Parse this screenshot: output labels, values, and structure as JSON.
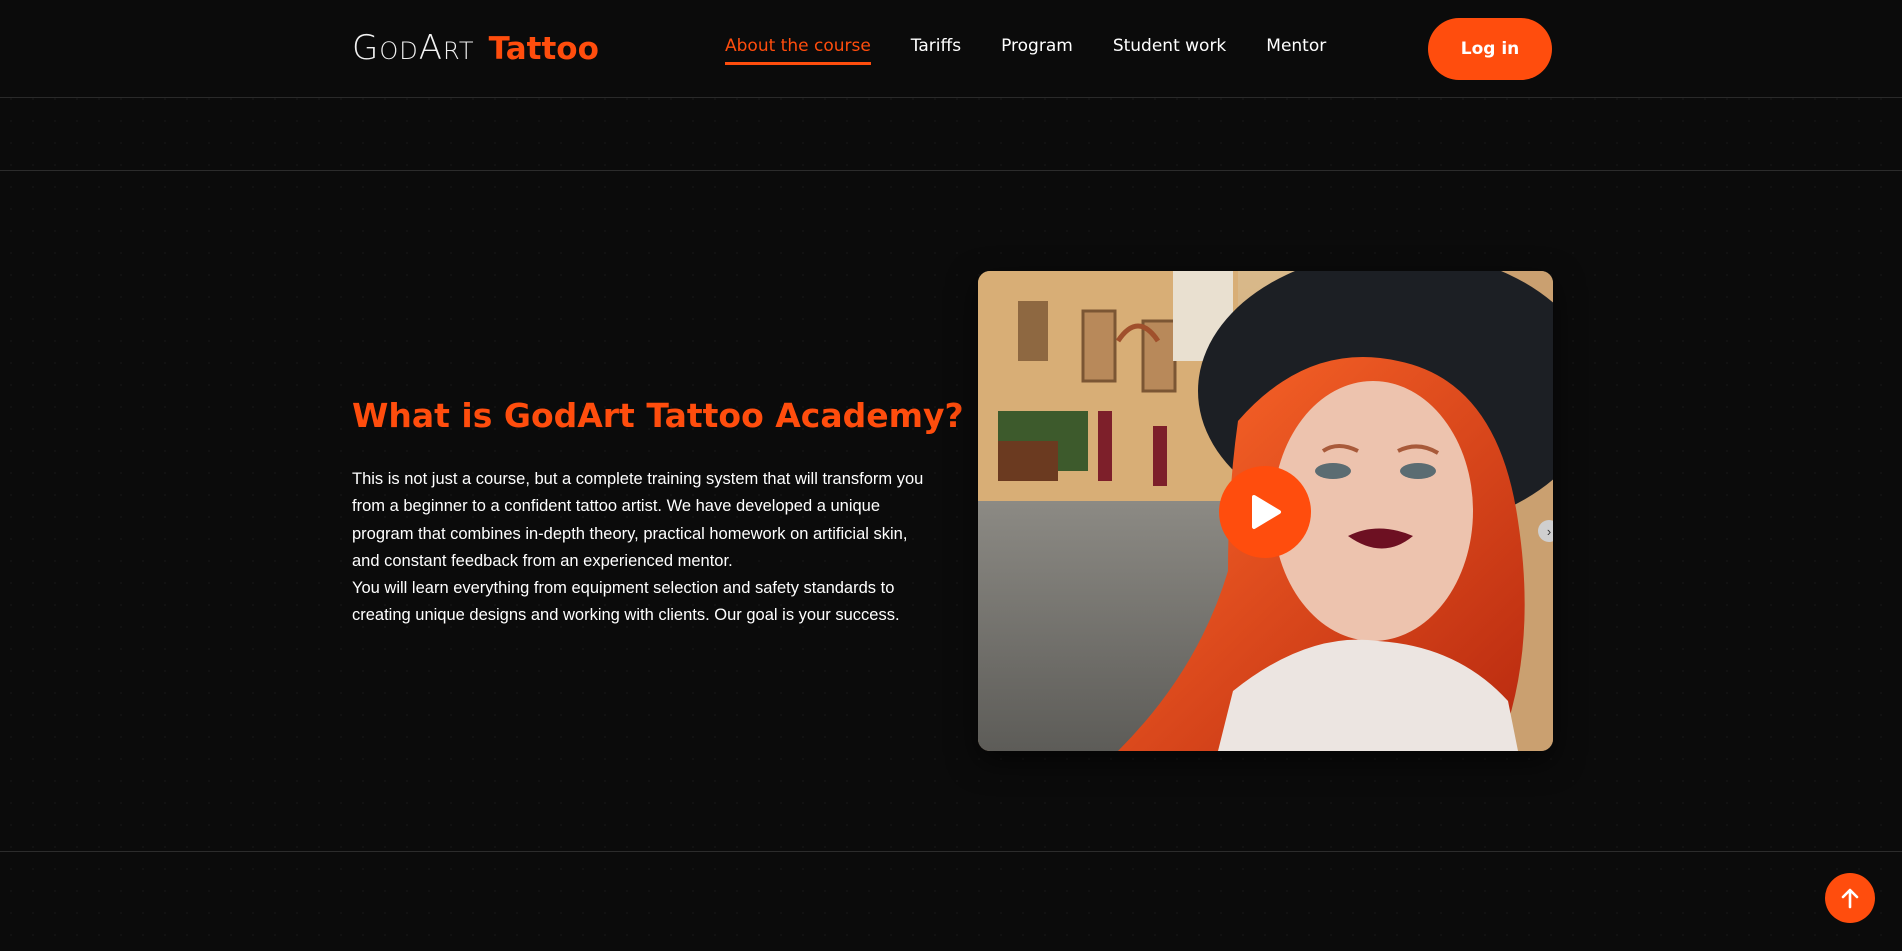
{
  "header": {
    "logo": {
      "godart": "GodArt",
      "tattoo": "Tattoo"
    },
    "nav": [
      {
        "label": "About the course",
        "active": true
      },
      {
        "label": "Tariffs",
        "active": false
      },
      {
        "label": "Program",
        "active": false
      },
      {
        "label": "Student work",
        "active": false
      },
      {
        "label": "Mentor",
        "active": false
      }
    ],
    "login_label": "Log in"
  },
  "about": {
    "title": "What is GodArt Tattoo Academy?",
    "paragraph_1": "This is not just a course, but a complete training system that will transform you from a beginner to a confident tattoo artist. We have developed a unique program that combines in-depth theory, practical homework on artificial skin, and constant feedback from an experienced mentor.",
    "paragraph_2": "You will learn everything from equipment selection and safety standards to creating unique designs and working with clients. Our goal is your success."
  },
  "colors": {
    "accent": "#ff4d0d",
    "background": "#0b0b0b",
    "text": "#ffffff"
  },
  "icons": {
    "play": "play-icon",
    "scroll_top": "arrow-up-icon",
    "video_next": "chevron-right-icon"
  }
}
